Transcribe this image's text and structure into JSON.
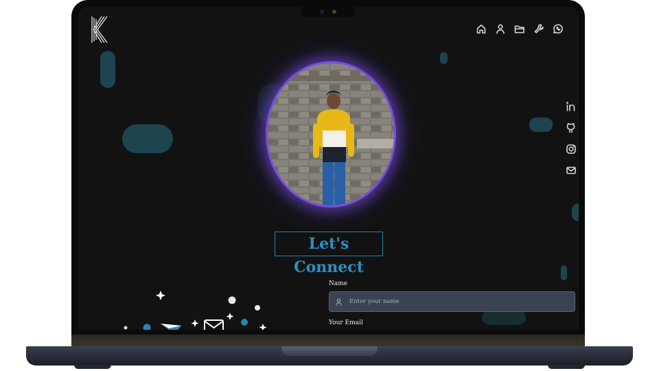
{
  "nav": {
    "items": [
      {
        "name": "home-icon"
      },
      {
        "name": "user-icon"
      },
      {
        "name": "folder-icon"
      },
      {
        "name": "wrench-icon"
      },
      {
        "name": "whatsapp-icon"
      }
    ]
  },
  "social": {
    "items": [
      {
        "name": "linkedin-icon"
      },
      {
        "name": "github-icon"
      },
      {
        "name": "instagram-icon"
      },
      {
        "name": "mail-icon"
      }
    ]
  },
  "contact": {
    "heading": "Let's Connect",
    "name_label": "Name",
    "name_placeholder": "Enter your name",
    "email_label": "Your Email"
  },
  "colors": {
    "accent": "#2a91c4",
    "glow": "#7b4be0",
    "background": "#121212",
    "input_bg": "#3b4252"
  }
}
